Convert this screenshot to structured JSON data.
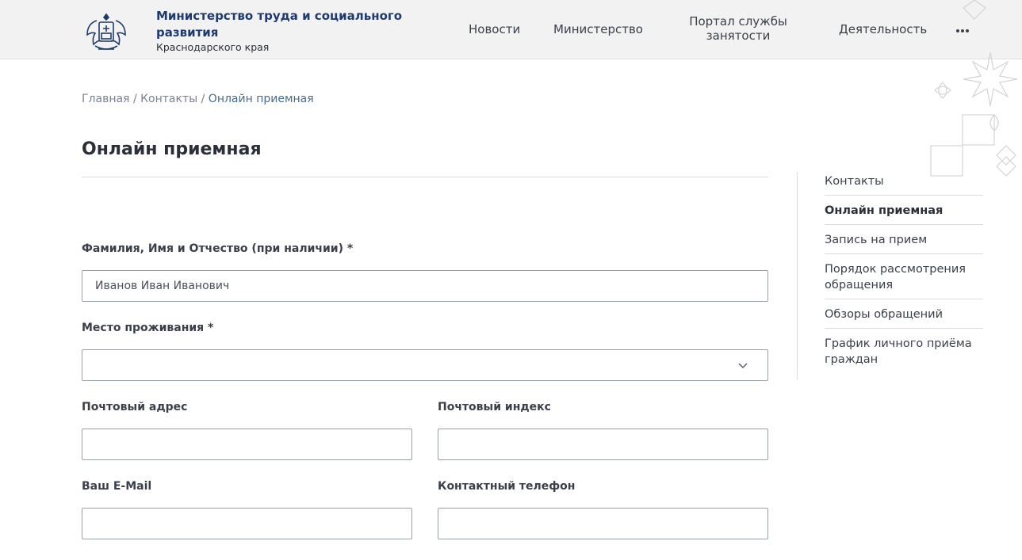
{
  "header": {
    "org_title": "Министерство труда и социального развития",
    "org_subtitle": "Краснодарского края",
    "nav": {
      "news": "Новости",
      "ministry": "Министерство",
      "portal": "Портал службы занятости",
      "activity": "Деятельность"
    },
    "more_icon": "more-dots-icon",
    "logo_icon": "coat-of-arms-icon"
  },
  "breadcrumb": {
    "home": "Главная",
    "contacts": "Контакты",
    "current": "Онлайн приемная",
    "separator": "/"
  },
  "page_title": "Онлайн приемная",
  "form": {
    "fio_label": "Фамилия, Имя и Отчество (при наличии) *",
    "fio_value": "Иванов Иван Иванович",
    "residence_label": "Место проживания *",
    "residence_value": "",
    "postal_address_label": "Почтовый адрес",
    "postal_address_value": "",
    "postal_index_label": "Почтовый индекс",
    "postal_index_value": "",
    "email_label": "Ваш E-Mail",
    "email_value": "",
    "phone_label": "Контактный телефон",
    "phone_value": ""
  },
  "sidebar": {
    "items": [
      {
        "label": "Контакты",
        "active": false
      },
      {
        "label": "Онлайн приемная",
        "active": true
      },
      {
        "label": "Запись на прием",
        "active": false
      },
      {
        "label": "Порядок рассмотрения обращения",
        "active": false
      },
      {
        "label": "Обзоры обращений",
        "active": false
      },
      {
        "label": "График личного приёма граждан",
        "active": false
      }
    ]
  },
  "colors": {
    "brand": "#1f3b6e",
    "header_bg": "#f2f2f2",
    "text": "#2b2f3a",
    "border": "#9aa0a8"
  }
}
